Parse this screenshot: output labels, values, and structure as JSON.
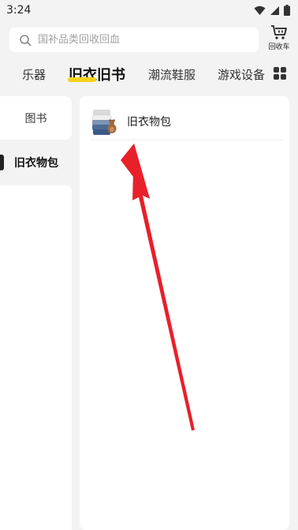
{
  "status_bar": {
    "time": "3:24",
    "icons": [
      "wifi-icon",
      "signal-icon",
      "battery-icon"
    ]
  },
  "search": {
    "placeholder": "国补品类回收回血",
    "value": ""
  },
  "cart": {
    "label": "回收车",
    "icon": "cart-icon"
  },
  "category_tabs": {
    "items": [
      {
        "label": "乐器",
        "active": false
      },
      {
        "label": "旧衣旧书",
        "active": true
      },
      {
        "label": "潮流鞋服",
        "active": false
      },
      {
        "label": "游戏设备",
        "active": false
      }
    ],
    "more_icon": "grid-icon"
  },
  "sidebar": {
    "items": [
      {
        "label": "图书",
        "active": false
      },
      {
        "label": "旧衣物包",
        "active": true
      }
    ]
  },
  "content": {
    "products": [
      {
        "label": "旧衣物包",
        "icon": "clothes-pile-icon"
      }
    ]
  },
  "colors": {
    "background": "#f3f3f3",
    "panel": "#ffffff",
    "accent_underline": "#f7d21c",
    "annotation_arrow": "#e8202a"
  }
}
